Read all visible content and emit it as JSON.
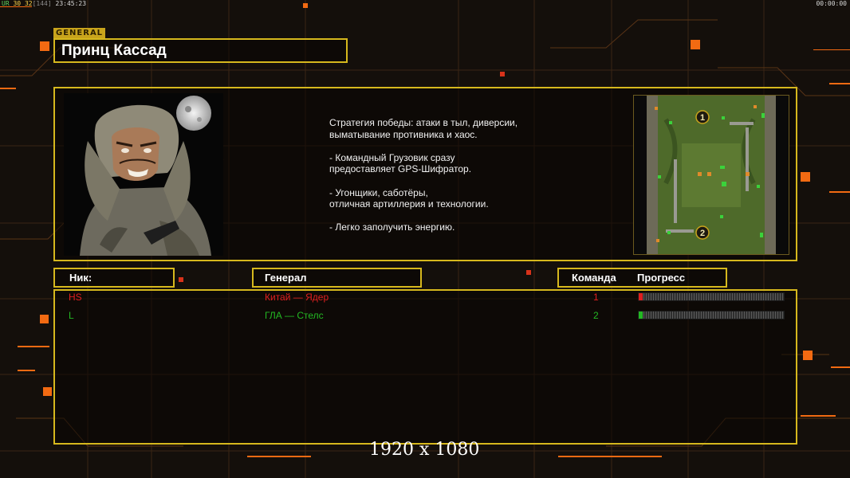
{
  "hud": {
    "left_prefix": "UR",
    "left_a": "30",
    "left_b": "32",
    "left_c": "[144]",
    "time": "23:45:23",
    "right_time": "00:00:00"
  },
  "header": {
    "tag": "GENERAL",
    "general_name": "Принц Кассад"
  },
  "briefing": {
    "portrait_icon": "general-portrait",
    "description": "Стратегия победы: атаки в тыл, диверсии,\n выматывание противника и хаос.\n\n- Командный Грузовик сразу\nпредоставляет GPS-Шифратор.\n\n- Угонщики, саботёры,\nотличная артиллерия и технологии.\n\n- Легко заполучить энергию.",
    "map_icon": "minimap",
    "map_markers": [
      "1",
      "2"
    ]
  },
  "table": {
    "col_nick": "Ник:",
    "col_general": "Генерал",
    "col_team": "Команда",
    "col_progress": "Прогресс",
    "rows": [
      {
        "nick": "HS",
        "general": "Китай — Ядер",
        "team": "1",
        "color": "#e01f1f",
        "progress": 0.01
      },
      {
        "nick": "L",
        "general": "ГЛА — Стелс",
        "team": "2",
        "color": "#23b823",
        "progress": 0.01
      }
    ]
  },
  "colors": {
    "accent": "#d6b81d",
    "background": "#140f0b",
    "grid_orange": "#f26a12"
  },
  "footer": {
    "resolution": "1920 x 1080"
  }
}
